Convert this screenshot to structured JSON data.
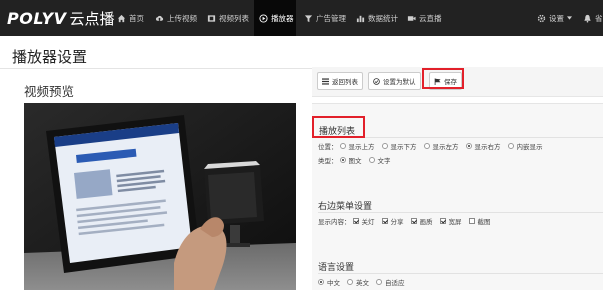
{
  "brand": {
    "logo_text": "POLYV",
    "logo_cn": "云点播"
  },
  "nav": {
    "items": [
      {
        "label": "首页",
        "icon": "home-icon"
      },
      {
        "label": "上传视频",
        "icon": "cloud-upload-icon"
      },
      {
        "label": "视频列表",
        "icon": "film-icon"
      },
      {
        "label": "播放器",
        "icon": "play-circle-icon",
        "active": true
      },
      {
        "label": "广告管理",
        "icon": "filter-icon"
      },
      {
        "label": "数据统计",
        "icon": "bar-chart-icon"
      },
      {
        "label": "云直播",
        "icon": "video-camera-icon"
      }
    ],
    "settings_label": "设置",
    "user_label": "省"
  },
  "page": {
    "title": "播放器设置"
  },
  "preview": {
    "heading": "视频预览"
  },
  "toolbar": {
    "back_label": "返回列表",
    "default_label": "设置为默认",
    "save_label": "保存"
  },
  "playlist": {
    "title": "播放列表",
    "position_label": "位置：",
    "position_options": [
      "显示上方",
      "显示下方",
      "显示左方",
      "显示右方",
      "内嵌显示"
    ],
    "position_selected": "显示右方",
    "type_label": "类型：",
    "type_options": [
      "图文",
      "文字"
    ],
    "type_selected": "图文"
  },
  "right_menu": {
    "title": "右边菜单设置",
    "content_label": "显示内容：",
    "options": [
      {
        "label": "关灯",
        "checked": true
      },
      {
        "label": "分享",
        "checked": true
      },
      {
        "label": "画质",
        "checked": true
      },
      {
        "label": "宽屏",
        "checked": true
      },
      {
        "label": "截图",
        "checked": false
      }
    ]
  },
  "language": {
    "title": "语言设置",
    "options": [
      "中文",
      "英文",
      "自适应"
    ],
    "selected": "中文"
  },
  "colors": {
    "navbar": "#222222",
    "highlight": "#e2202a"
  }
}
